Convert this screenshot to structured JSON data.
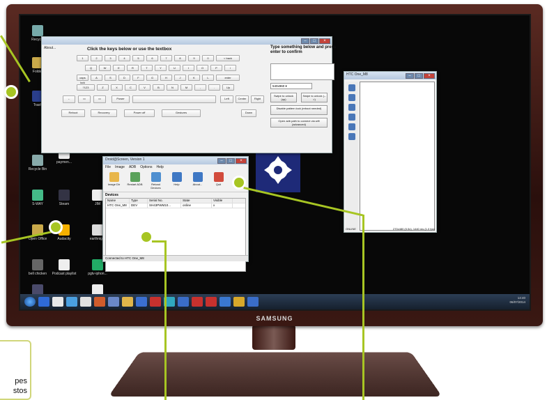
{
  "desktop": {
    "icons": [
      {
        "label": "Recycle",
        "color": "#7aa"
      },
      {
        "label": "Folder",
        "color": "#c9a94a"
      },
      {
        "label": "Trash",
        "color": "#2a3e8b"
      },
      {
        "label": "Recycle Bin",
        "color": "#8aa"
      },
      {
        "label": "S-WAY",
        "color": "#4b8"
      },
      {
        "label": "Open Office",
        "color": "#c9a94a"
      },
      {
        "label": "bell chicken",
        "color": "#666"
      },
      {
        "label": "Podcast playlist",
        "color": "#eee"
      },
      {
        "label": "Briefing",
        "color": "#4a4a6a"
      },
      {
        "label": "Audacity",
        "color": "#f4b000"
      },
      {
        "label": "earthnight",
        "color": "#ddd"
      },
      {
        "label": "Steam",
        "color": "#334"
      },
      {
        "label": "JIM",
        "color": "#eee"
      },
      {
        "label": "pgtv-iphon...",
        "color": "#2a6"
      },
      {
        "label": "Starter Form and Back ...",
        "color": "#eee"
      },
      {
        "label": "paymen...",
        "color": "#eee"
      }
    ]
  },
  "keyboard_window": {
    "menu": "About...",
    "title": "Click the keys below or use the textbox",
    "row1": [
      "1",
      "2",
      "3",
      "4",
      "5",
      "6",
      "7",
      "8",
      "9",
      "0",
      "< back"
    ],
    "row2": [
      "Q",
      "W",
      "E",
      "R",
      "T",
      "Y",
      "U",
      "I",
      "O",
      "P",
      "/"
    ],
    "row3": [
      "caps lock",
      "A",
      "S",
      "D",
      "F",
      "G",
      "H",
      "J",
      "K",
      "L",
      "enter"
    ],
    "row4": [
      "?123",
      "Z",
      "X",
      "C",
      "V",
      "B",
      "N",
      "M",
      ",",
      ".",
      "Up"
    ],
    "row5": [
      "Power",
      "Left",
      "Center",
      "Right"
    ],
    "row6": [
      "Reboot",
      "Recovery",
      "Power off",
      "Gestures",
      "Down"
    ],
    "right_title": "Type something below and press enter to confirm",
    "select_value": "540x960",
    "btn_swipe_up": "Swipe to unlock (up)",
    "btn_swipe_right": "Swipe to unlock (-->)",
    "btn_pattern": "Disable pattern lock (reboot needed)",
    "btn_adb": "Open adb path to connect via wifi (advanced)"
  },
  "droid_window": {
    "title": "Droid@Screen, Version 1",
    "menu": [
      "File",
      "Image",
      "ADB",
      "Options",
      "Help"
    ],
    "tools": [
      {
        "label": "Image Dir",
        "color": "#e8b64a"
      },
      {
        "label": "Restart ADB",
        "color": "#5aa25a"
      },
      {
        "label": "Reload Devices",
        "color": "#4f8fd0"
      },
      {
        "label": "Help",
        "color": "#3f78c4"
      },
      {
        "label": "About...",
        "color": "#3f78c4"
      },
      {
        "label": "Quit",
        "color": "#d24b3c"
      }
    ],
    "devices_label": "Devices",
    "columns": [
      "Name",
      "Type",
      "Serial No.",
      "State",
      "Visible"
    ],
    "rows": [
      [
        "HTC One_M8",
        "DEV",
        "SH43PWM10...",
        "online",
        "x"
      ]
    ],
    "status": "Connected to HTC One_M8"
  },
  "phone_window": {
    "title": "HTC One_M8",
    "status_left": "ONLINE",
    "status_right": "270x480 (0.5x), 1440 ms (1.0 fps)"
  },
  "taskbar": {
    "time": "14:40",
    "date": "06/07/2014",
    "apps": [
      "#2f6ad6",
      "#e8e8e8",
      "#4a9fe0",
      "#e2e2e2",
      "#d05c2c",
      "#6a88c8",
      "#e0b54a",
      "#3b6fd0",
      "#c7312e",
      "#30a8c0",
      "#3a6dc8",
      "#c7312e",
      "#c7312e",
      "#3a78d0",
      "#d8a82a",
      "#3a6dc8"
    ]
  },
  "tv": {
    "brand": "SAMSUNG"
  },
  "callout": {
    "text_lines": [
      "pes",
      "stos"
    ]
  },
  "colors": {
    "accent": "#a7c523",
    "droid_logo_bg": "#1e2a78"
  }
}
